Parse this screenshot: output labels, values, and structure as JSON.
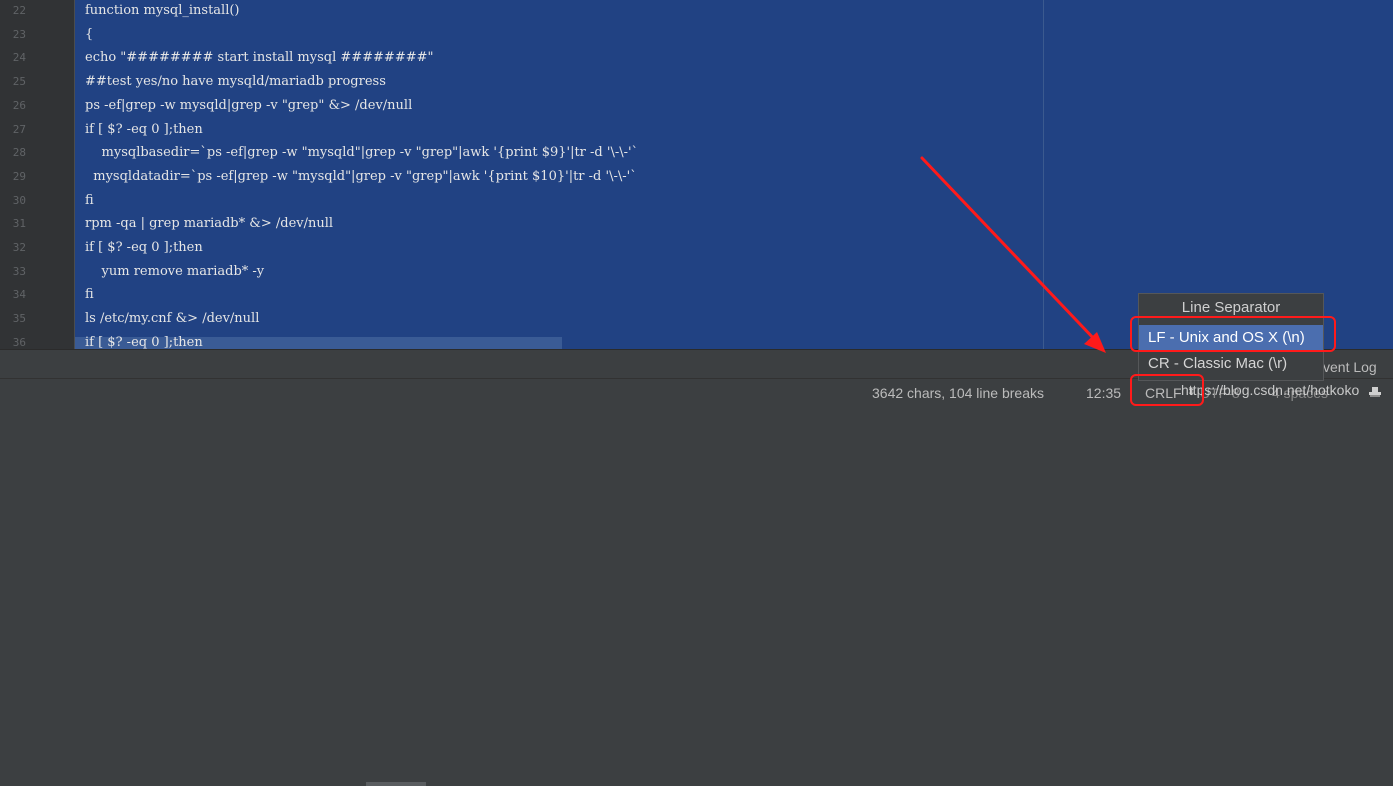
{
  "editor": {
    "lines": [
      {
        "num": "22",
        "text": "function mysql_install()"
      },
      {
        "num": "23",
        "text": "{"
      },
      {
        "num": "24",
        "text": "echo \"######## start install mysql ########\""
      },
      {
        "num": "25",
        "text": "##test yes/no have mysqld/mariadb progress"
      },
      {
        "num": "26",
        "text": "ps -ef|grep -w mysqld|grep -v \"grep\" &> /dev/null"
      },
      {
        "num": "27",
        "text": "if [ $? -eq 0 ];then"
      },
      {
        "num": "28",
        "text": "    mysqlbasedir=`ps -ef|grep -w \"mysqld\"|grep -v \"grep\"|awk '{print $9}'|tr -d '\\-\\-'`"
      },
      {
        "num": "29",
        "text": "  mysqldatadir=`ps -ef|grep -w \"mysqld\"|grep -v \"grep\"|awk '{print $10}'|tr -d '\\-\\-'`"
      },
      {
        "num": "30",
        "text": "fi"
      },
      {
        "num": "31",
        "text": "rpm -qa | grep mariadb* &> /dev/null"
      },
      {
        "num": "32",
        "text": "if [ $? -eq 0 ];then"
      },
      {
        "num": "33",
        "text": "    yum remove mariadb* -y"
      },
      {
        "num": "34",
        "text": "fi"
      },
      {
        "num": "35",
        "text": "ls /etc/my.cnf &> /dev/null"
      },
      {
        "num": "36",
        "text": "if [ $? -eq 0 ];then"
      }
    ]
  },
  "popup": {
    "title": "Line Separator",
    "items": [
      "LF - Unix and OS X (\\n)",
      "CR - Classic Mac (\\r)"
    ]
  },
  "toolbar": {
    "event_log": "vent Log"
  },
  "status": {
    "stats": "3642 chars, 104 line breaks",
    "position": "12:35",
    "line_separator": "CRLF",
    "encoding": "UTF-8",
    "indent": "4 spaces",
    "watermark": "https://blog.csdn.net/hotkoko"
  },
  "colors": {
    "selection": "#214283",
    "popup_selected": "#4b6eaf",
    "highlight": "#ff1a1a"
  }
}
